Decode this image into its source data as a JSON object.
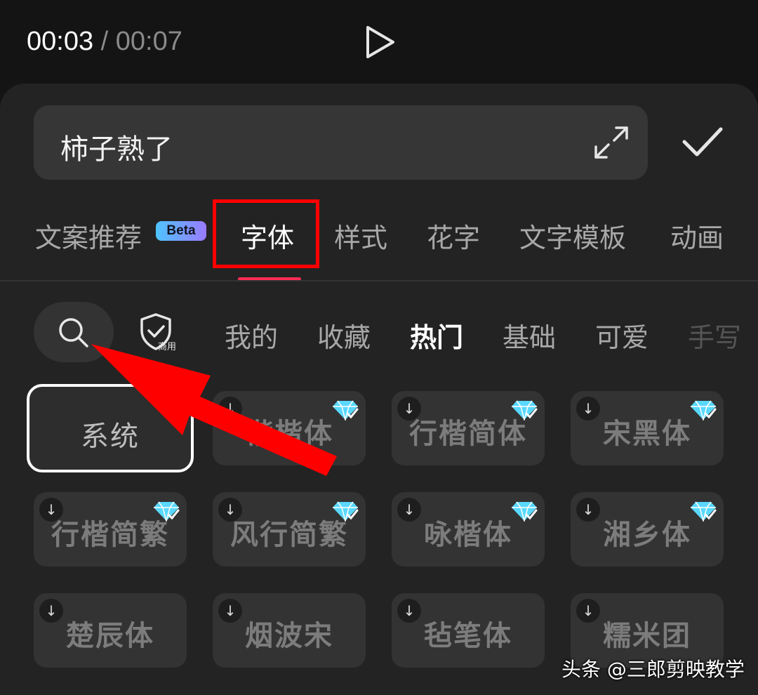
{
  "player": {
    "current_time": "00:03",
    "separator": "/",
    "duration": "00:07"
  },
  "text_input": {
    "value": "柿子熟了"
  },
  "tabs": [
    {
      "label": "文案推荐"
    },
    {
      "label": "字体"
    },
    {
      "label": "样式"
    },
    {
      "label": "花字"
    },
    {
      "label": "文字模板"
    },
    {
      "label": "动画"
    }
  ],
  "beta_badge": "Beta",
  "commercial_label": "商用",
  "categories": [
    {
      "label": "我的"
    },
    {
      "label": "收藏"
    },
    {
      "label": "热门"
    },
    {
      "label": "基础"
    },
    {
      "label": "可爱"
    },
    {
      "label": "手写"
    }
  ],
  "fonts": [
    {
      "name": "系统"
    },
    {
      "name": "楷楷体"
    },
    {
      "name": "行楷简体"
    },
    {
      "name": "宋黑体"
    },
    {
      "name": "行楷简繁"
    },
    {
      "name": "风行简繁"
    },
    {
      "name": "咏楷体"
    },
    {
      "name": "湘乡体"
    },
    {
      "name": "楚辰体"
    },
    {
      "name": "烟波宋"
    },
    {
      "name": "毡笔体"
    },
    {
      "name": "糯米团"
    }
  ],
  "watermark": "头条 @三郎剪映教学",
  "colors": {
    "highlight": "#ff0000",
    "tab_underline": "#ff2d55",
    "panel": "#232323"
  }
}
